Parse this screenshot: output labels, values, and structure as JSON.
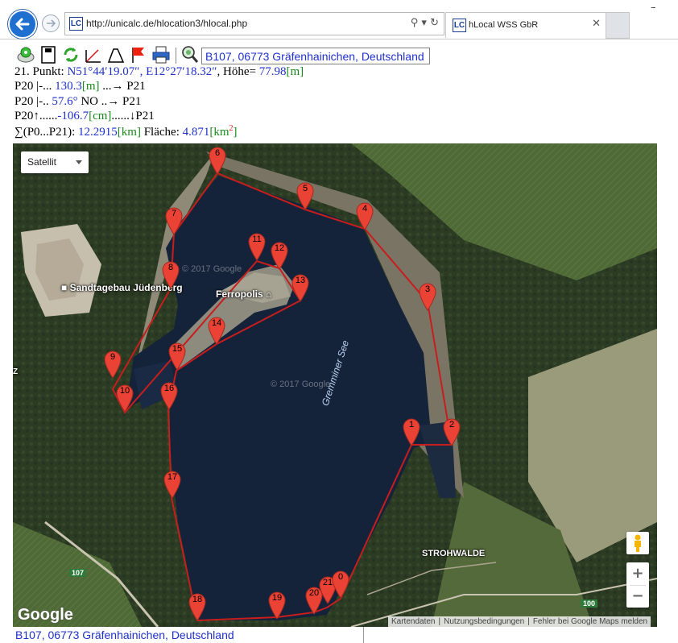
{
  "browser": {
    "url": "http://unicalc.de/hlocation3/hlocal.php",
    "tab_title": "hLocal WSS GbR",
    "logo_text": "LC"
  },
  "toolbar": {
    "icons": [
      "gps-icon",
      "save-icon",
      "refresh-icon",
      "angle-icon",
      "triangle-icon",
      "flag-icon",
      "print-icon",
      "search-icon"
    ],
    "location": "B107, 06773 Gräfenhainichen, Deutschland"
  },
  "info": {
    "point_prefix": "21. Punkt: ",
    "lat": "N51°44′19.07″",
    "sep1": ", ",
    "lon": "E12°27′18.32″",
    "height_label": ", Höhe= ",
    "height_value": "77.98",
    "height_unit": "[m]",
    "dist_prefix": "P20 |-... ",
    "dist_value": "130.3",
    "dist_unit": "[m]",
    "dist_suffix": " ...→ P21",
    "bearing_prefix": "P20 |-.. ",
    "bearing_value": "57.6°",
    "bearing_dir": " NO ..→ P21",
    "elev_prefix": "P20↑......",
    "elev_value": "-106.7",
    "elev_unit": "[cm]",
    "elev_suffix": "......↓P21",
    "sum_prefix": "∑(P0...P21): ",
    "sum_value": "12.2915",
    "sum_unit": "[km]",
    "area_label": " Fläche: ",
    "area_value": "4.871",
    "area_unit_open": "[km",
    "area_unit_exp": "2",
    "area_unit_close": "]"
  },
  "map": {
    "map_type": "Satellit",
    "labels": {
      "sandtagebau": "Sandtagebau Jüdenberg",
      "ferropolis": "Ferropolis",
      "lake": "Gremminer See",
      "strohwalde": "STROHWALDE",
      "z": "Z"
    },
    "watermark": "© 2017 Google",
    "google_logo": "Google",
    "road_107": "107",
    "road_100": "100",
    "zoom_in": "+",
    "zoom_out": "−",
    "footer": [
      "Kartendaten",
      "Nutzungsbedingungen",
      "Fehler bei Google Maps melden"
    ],
    "markers": [
      "1",
      "2",
      "3",
      "4",
      "5",
      "6",
      "7",
      "8",
      "9",
      "10",
      "11",
      "12",
      "13",
      "14",
      "15",
      "16",
      "17",
      "18",
      "19",
      "20",
      "21",
      "0"
    ],
    "polygon_color": "#c81d1d",
    "marker_color": "#ea4335"
  },
  "bottom_location": "B107, 06773 Gräfenhainichen, Deutschland"
}
